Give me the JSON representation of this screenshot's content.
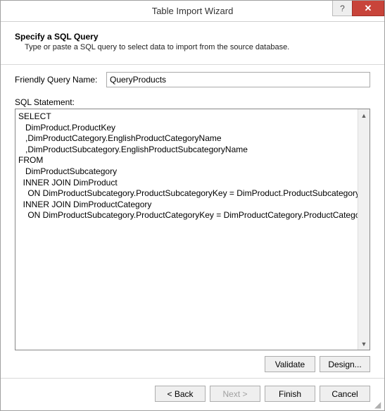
{
  "window": {
    "title": "Table Import Wizard",
    "help_glyph": "?",
    "close_glyph": "✕"
  },
  "header": {
    "title": "Specify a SQL Query",
    "subtitle": "Type or paste a SQL query to select data to import from the source database."
  },
  "form": {
    "friendly_label": "Friendly Query Name:",
    "friendly_value": "QueryProducts",
    "sql_label": "SQL Statement:",
    "sql_text": "SELECT\n   DimProduct.ProductKey\n   ,DimProductCategory.EnglishProductCategoryName\n   ,DimProductSubcategory.EnglishProductSubcategoryName\nFROM\n   DimProductSubcategory\n  INNER JOIN DimProduct\n    ON DimProductSubcategory.ProductSubcategoryKey = DimProduct.ProductSubcategoryKey\n  INNER JOIN DimProductCategory\n    ON DimProductSubcategory.ProductCategoryKey = DimProductCategory.ProductCategoryKey"
  },
  "buttons": {
    "validate": "Validate",
    "design": "Design...",
    "back": "< Back",
    "next": "Next >",
    "finish": "Finish",
    "cancel": "Cancel"
  }
}
